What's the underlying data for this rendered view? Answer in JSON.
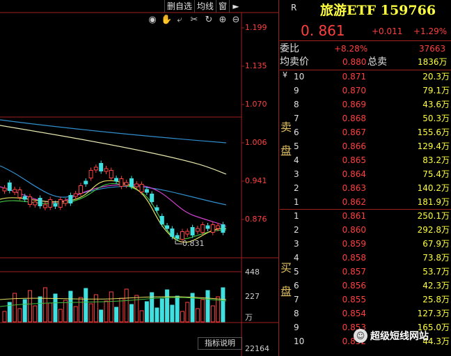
{
  "toolbar": {
    "delete_label": "删自选",
    "ma_label": "均线",
    "window_label": "窗"
  },
  "chart": {
    "price_axis": [
      "1.199",
      "1.135",
      "1.070",
      "1.006",
      "0.941",
      "0.876"
    ],
    "low_marker": "0.831",
    "volume_axis": [
      "448",
      "227"
    ],
    "volume_unit": "万",
    "indicator_label": "指标说明",
    "bottom_value": "22164"
  },
  "quote": {
    "market_tag": "R",
    "title": "旅游ETF 159766",
    "last_price": "0. 861",
    "change": "+0.011",
    "change_pct": "+1.29%",
    "weibi_label": "委比",
    "weibi_value": "+8.28%",
    "weibi_diff": "37663",
    "avg_sell_label": "均卖价",
    "avg_sell_value": "0.880",
    "total_sell_label": "总卖",
    "total_sell_value": "1836万",
    "sell_side_top": "卖",
    "sell_side_bottom": "盘",
    "buy_side_top": "买",
    "buy_side_bottom": "盘",
    "sell": [
      {
        "level": "10",
        "price": "0.871",
        "vol": "20.3万"
      },
      {
        "level": "9",
        "price": "0.870",
        "vol": "79.1万"
      },
      {
        "level": "8",
        "price": "0.869",
        "vol": "43.6万"
      },
      {
        "level": "7",
        "price": "0.868",
        "vol": "50.3万"
      },
      {
        "level": "6",
        "price": "0.867",
        "vol": "155.6万"
      },
      {
        "level": "5",
        "price": "0.866",
        "vol": "129.4万"
      },
      {
        "level": "4",
        "price": "0.865",
        "vol": "83.2万"
      },
      {
        "level": "3",
        "price": "0.864",
        "vol": "75.4万"
      },
      {
        "level": "2",
        "price": "0.863",
        "vol": "140.2万"
      },
      {
        "level": "1",
        "price": "0.862",
        "vol": "181.9万"
      }
    ],
    "buy": [
      {
        "level": "1",
        "price": "0.861",
        "vol": "250.1万"
      },
      {
        "level": "2",
        "price": "0.860",
        "vol": "292.8万"
      },
      {
        "level": "3",
        "price": "0.859",
        "vol": "67.9万"
      },
      {
        "level": "4",
        "price": "0.858",
        "vol": "73.8万"
      },
      {
        "level": "5",
        "price": "0.857",
        "vol": "53.7万"
      },
      {
        "level": "6",
        "price": "0.856",
        "vol": "42.3万"
      },
      {
        "level": "7",
        "price": "0.855",
        "vol": "25.8万"
      },
      {
        "level": "8",
        "price": "0.854",
        "vol": "127.3万"
      },
      {
        "level": "9",
        "price": "0.853",
        "vol": "165.0万"
      },
      {
        "level": "10",
        "price": "0.852",
        "vol": "44.3万"
      }
    ]
  },
  "watermark": {
    "text": "超级短线网站"
  },
  "colors": {
    "up": "#ff4040",
    "down": "#40e0e0",
    "volume_text": "#ffff40"
  }
}
